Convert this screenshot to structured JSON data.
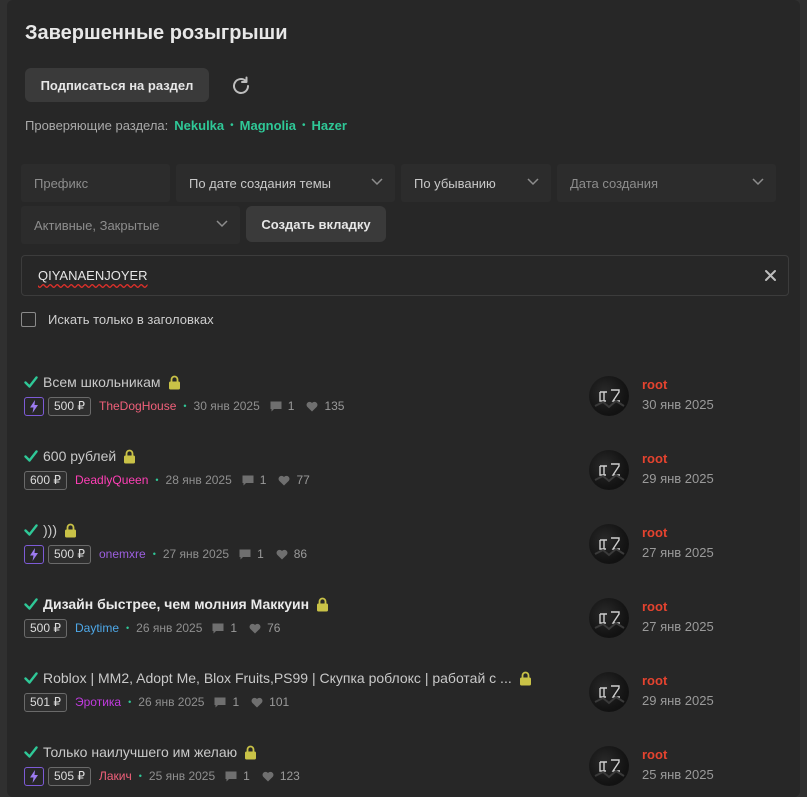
{
  "page": {
    "title": "Завершенные розыгрыши",
    "subscribe_label": "Подписаться на раздел",
    "moderators_label": "Проверяющие раздела:",
    "moderators": [
      "Nekulka",
      "Magnolia",
      "Hazer"
    ]
  },
  "filters": {
    "prefix_placeholder": "Префикс",
    "sort_by": "По дате создания темы",
    "order": "По убыванию",
    "date_placeholder": "Дата создания",
    "state": "Активные, Закрытые",
    "create_tab_label": "Создать вкладку"
  },
  "search": {
    "value": "QIYANAENJOYER",
    "titles_only_label": "Искать только в заголовках"
  },
  "threads": [
    {
      "title": "Всем школьникам",
      "bolt": true,
      "price": "500 ₽",
      "author": "TheDogHouse",
      "author_color": "#f0607a",
      "date": "30 янв 2025",
      "comments": "1",
      "likes": "135",
      "last_user": "root",
      "last_date": "30 янв 2025"
    },
    {
      "title": "600 рублей",
      "bolt": false,
      "price": "600 ₽",
      "author": "DeadlyQueen",
      "author_color": "#ff3fb6",
      "date": "28 янв 2025",
      "comments": "1",
      "likes": "77",
      "last_user": "root",
      "last_date": "29 янв 2025"
    },
    {
      "title": ")))",
      "bolt": true,
      "price": "500 ₽",
      "author": "onemxre",
      "author_color": "#9c5fe0",
      "date": "27 янв 2025",
      "comments": "1",
      "likes": "86",
      "last_user": "root",
      "last_date": "27 янв 2025"
    },
    {
      "title": "Дизайн быстрее, чем молния Маккуин",
      "bold": true,
      "bolt": false,
      "price": "500 ₽",
      "author": "Daytime",
      "author_color": "#4ea8e8",
      "date": "26 янв 2025",
      "comments": "1",
      "likes": "76",
      "last_user": "root",
      "last_date": "27 янв 2025"
    },
    {
      "title": "Roblox | MM2, Adopt Me, Blox Fruits,PS99 | Скупка роблокс | работай с ...",
      "bolt": false,
      "price": "501 ₽",
      "author": "Эротика",
      "author_color": "#c23be0",
      "date": "26 янв 2025",
      "comments": "1",
      "likes": "101",
      "last_user": "root",
      "last_date": "29 янв 2025"
    },
    {
      "title": "Только наилучшего им желаю",
      "bolt": true,
      "price": "505 ₽",
      "author": "Лакич",
      "author_color": "#f0607a",
      "date": "25 янв 2025",
      "comments": "1",
      "likes": "123",
      "last_user": "root",
      "last_date": "25 янв 2025"
    }
  ],
  "colors": {
    "accent_green": "#2fc897",
    "lock_yellow": "#c9c247",
    "last_user_red": "#e5432f"
  }
}
